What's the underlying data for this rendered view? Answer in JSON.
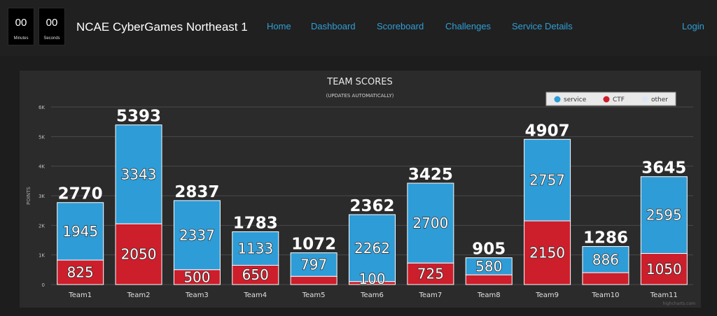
{
  "timer": {
    "minutes_value": "00",
    "minutes_label": "Minutes",
    "seconds_value": "00",
    "seconds_label": "Seconds"
  },
  "brand": "NCAE CyberGames Northeast 1",
  "nav": {
    "items": [
      "Home",
      "Dashboard",
      "Scoreboard",
      "Challenges",
      "Service Details"
    ],
    "login": "Login"
  },
  "colors": {
    "service": "#2e9cd6",
    "ctf": "#cc1e2b",
    "other": "#dde6f2",
    "link": "#2f9fd7"
  },
  "chart_data": {
    "type": "bar",
    "stacked": true,
    "title": "TEAM SCORES",
    "subtitle": "(UPDATES AUTOMATICALLY)",
    "ylabel": "POINTS",
    "ylim": [
      0,
      6000
    ],
    "yticks": [
      "0",
      "1K",
      "2K",
      "3K",
      "4K",
      "5K",
      "6K"
    ],
    "grid": true,
    "legend_position": "top-right",
    "categories": [
      "Team1",
      "Team2",
      "Team3",
      "Team4",
      "Team5",
      "Team6",
      "Team7",
      "Team8",
      "Team9",
      "Team10",
      "Team11"
    ],
    "series": [
      {
        "name": "CTF",
        "values": [
          825,
          2050,
          500,
          650,
          275,
          100,
          725,
          325,
          2150,
          400,
          1050
        ],
        "labels": [
          "825",
          "2050",
          "500",
          "650",
          "",
          "100",
          "725",
          "",
          "2150",
          "",
          "1050"
        ]
      },
      {
        "name": "service",
        "values": [
          1945,
          3343,
          2337,
          1133,
          797,
          2262,
          2700,
          580,
          2757,
          886,
          2595
        ],
        "labels": [
          "1945",
          "3343",
          "2337",
          "1133",
          "797",
          "2262",
          "2700",
          "580",
          "2757",
          "886",
          "2595"
        ]
      },
      {
        "name": "other",
        "values": [
          0,
          0,
          0,
          0,
          0,
          0,
          0,
          0,
          0,
          0,
          0
        ],
        "labels": [
          "",
          "",
          "",
          "",
          "",
          "",
          "",
          "",
          "",
          "",
          ""
        ]
      }
    ],
    "totals": [
      "2770",
      "5393",
      "2837",
      "1783",
      "1072",
      "2362",
      "3425",
      "905",
      "4907",
      "1286",
      "3645"
    ],
    "credit": "highcharts.com"
  }
}
